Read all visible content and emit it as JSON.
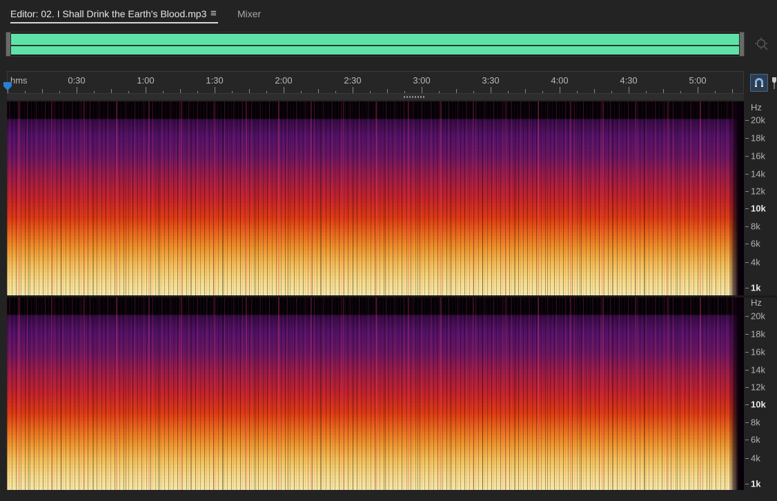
{
  "tabs": {
    "editor_label": "Editor: 02. I Shall Drink the Earth's Blood.mp3",
    "menu_glyph": "≡",
    "mixer_label": "Mixer"
  },
  "overview": {
    "color": "#5fe2a7"
  },
  "ruler": {
    "unit": "hms",
    "labels": [
      "0:30",
      "1:00",
      "1:30",
      "2:00",
      "2:30",
      "3:00",
      "3:30",
      "4:00",
      "4:30",
      "5:00"
    ]
  },
  "freq_scale": {
    "unit": "Hz",
    "labels": [
      "20k",
      "18k",
      "16k",
      "14k",
      "12k",
      "10k",
      "8k",
      "6k",
      "4k",
      "1k"
    ],
    "bold": [
      "10k",
      "1k"
    ]
  },
  "colors": {
    "accent": "#2a7fd4",
    "spectrogram_low": "#fde08a",
    "spectrogram_mid": "#e23a12",
    "spectrogram_high": "#55106a"
  }
}
